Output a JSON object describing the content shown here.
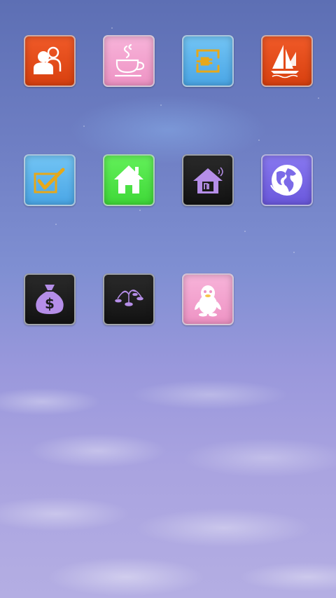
{
  "wallpaper": {
    "name": "sky-clouds-wallpaper"
  },
  "apps": [
    {
      "id": "contacts",
      "icon": "people-icon",
      "color": "#e84a1c"
    },
    {
      "id": "tea",
      "icon": "tea-cup-icon",
      "color": "#f4a2cf"
    },
    {
      "id": "sync",
      "icon": "plug-sync-icon",
      "color": "#5fb7ee"
    },
    {
      "id": "sailing",
      "icon": "sailboat-icon",
      "color": "#e84a1c"
    },
    {
      "id": "tasks",
      "icon": "checkbox-icon",
      "color": "#5fb7ee"
    },
    {
      "id": "home",
      "icon": "house-icon",
      "color": "#4fe84a"
    },
    {
      "id": "mi-home",
      "icon": "mi-house-icon",
      "color": "#1c1c1c"
    },
    {
      "id": "browser",
      "icon": "globe-icon",
      "color": "#7b6ae8"
    },
    {
      "id": "wallet",
      "icon": "money-bag-icon",
      "color": "#1c1c1c"
    },
    {
      "id": "fountain",
      "icon": "fountain-icon",
      "color": "#1c1c1c"
    },
    {
      "id": "qq",
      "icon": "penguin-icon",
      "color": "#f4a2cf"
    }
  ]
}
